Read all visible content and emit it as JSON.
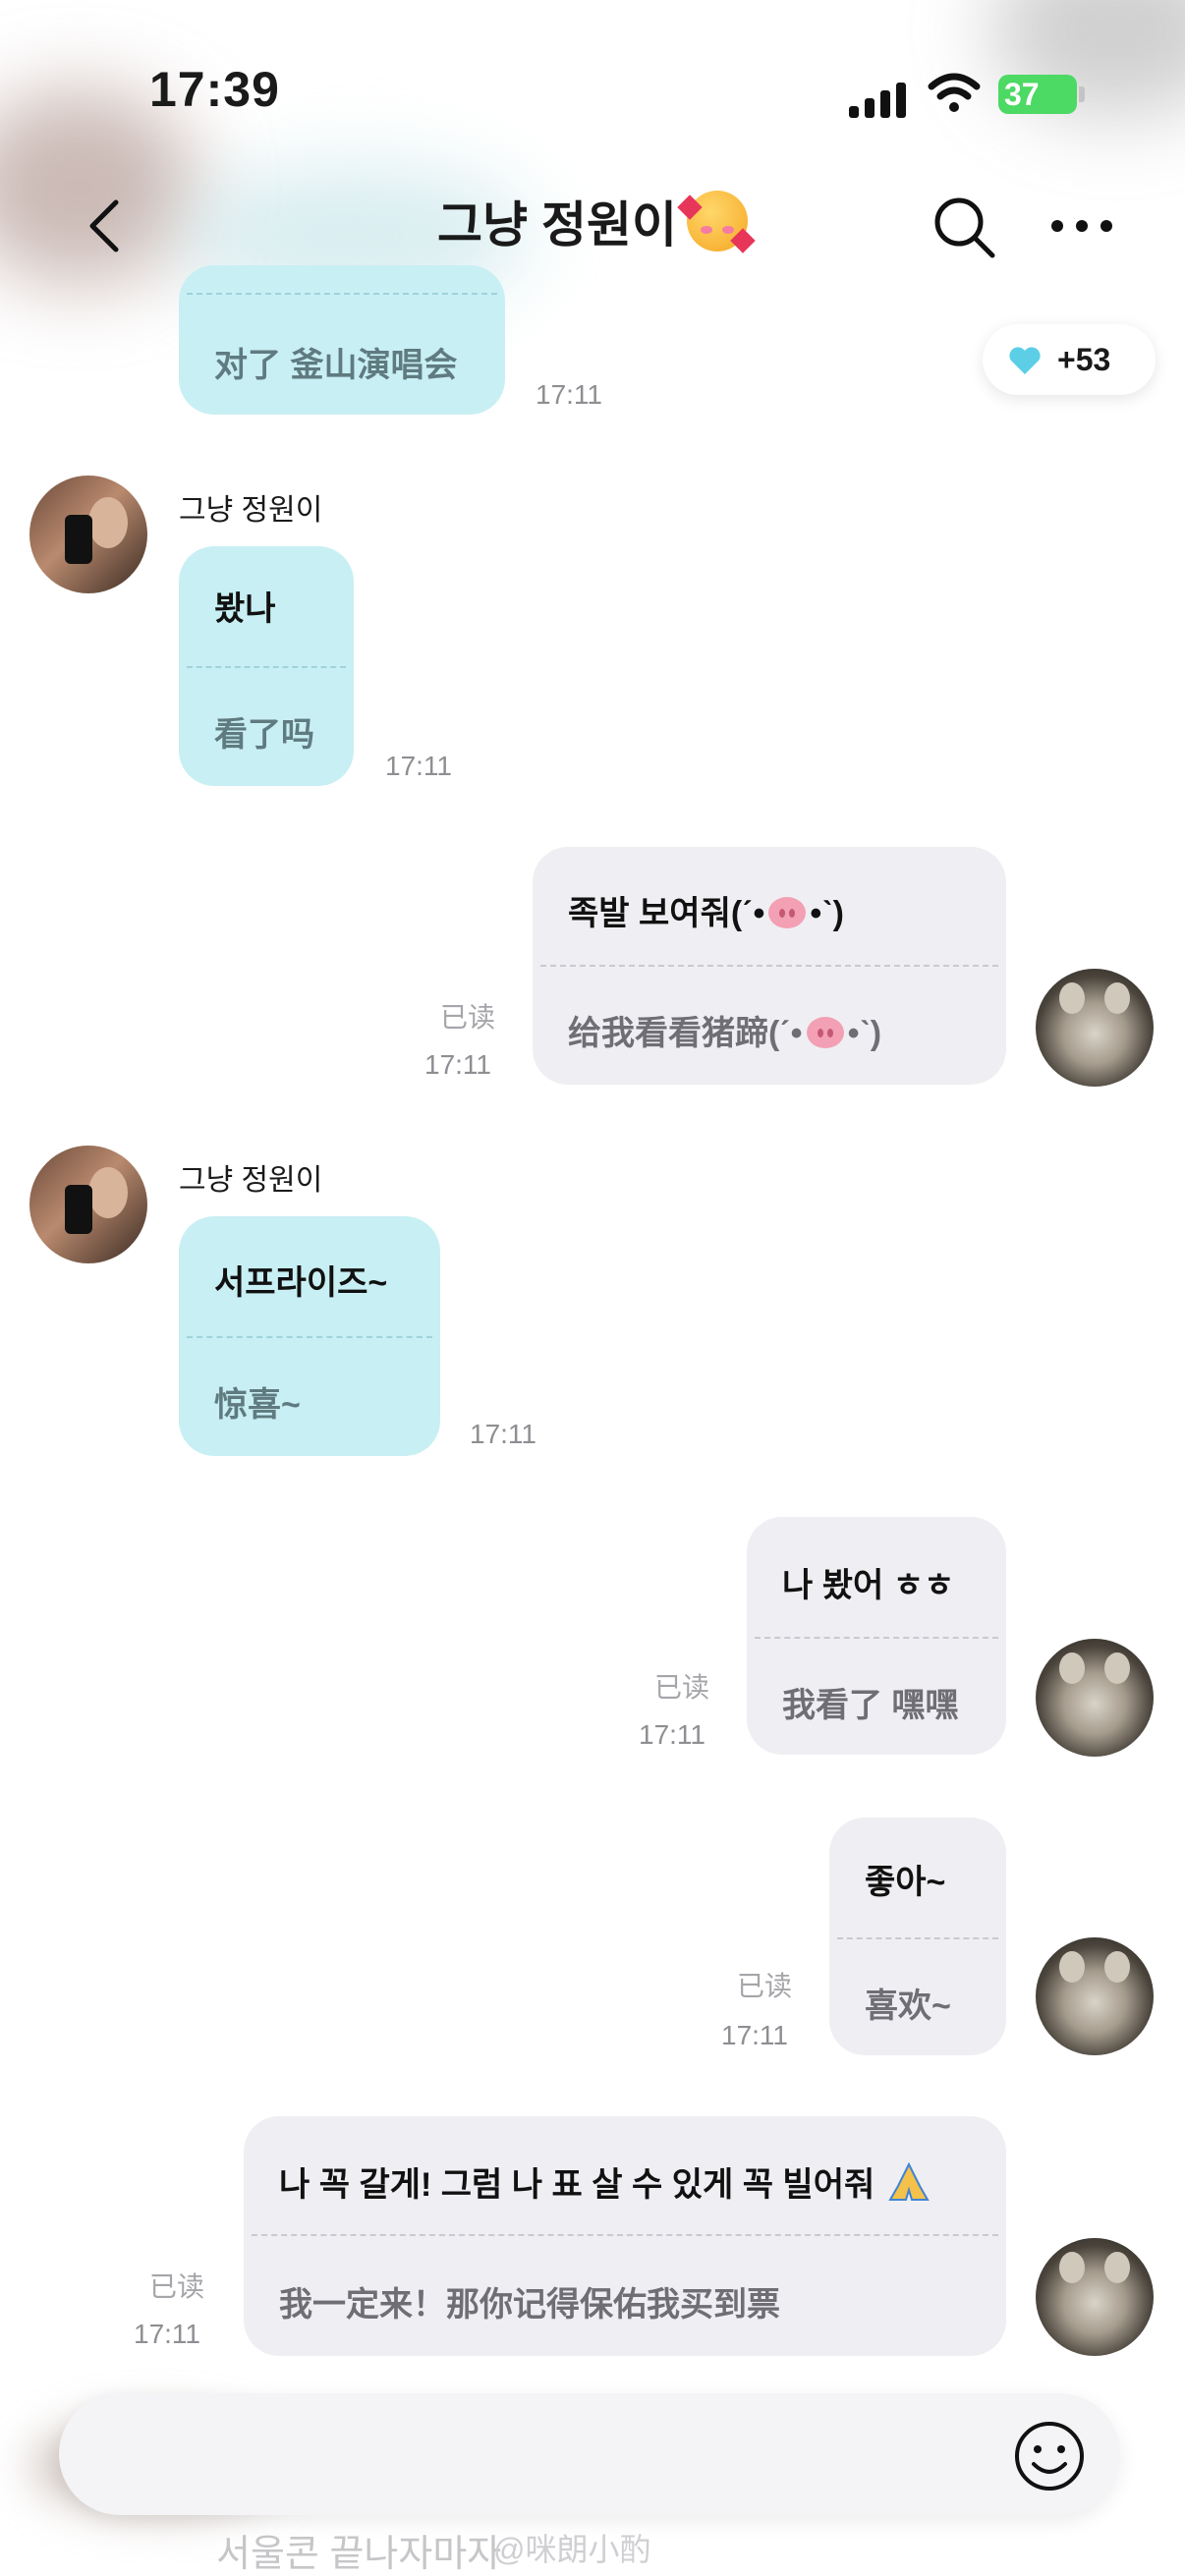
{
  "status_bar": {
    "time": "17:39",
    "battery": "37"
  },
  "header": {
    "title": "그냥 정원이",
    "title_emoji": "smiling-face-with-hearts-icon"
  },
  "like_badge": {
    "count": "+53",
    "color": "#5ccfe6"
  },
  "colors": {
    "incoming_bubble": "#c8eff4",
    "outgoing_bubble": "#efeff3"
  },
  "messages": [
    {
      "direction": "in",
      "lines": [
        "对了 釜山演唱会"
      ],
      "time": "17:11"
    },
    {
      "direction": "in",
      "sender": "그냥 정원이",
      "lines": [
        "봤나",
        "看了吗"
      ],
      "time": "17:11"
    },
    {
      "direction": "out",
      "lines": [
        "족발 보여줘(ˊ•",
        "•ˋ)",
        "给我看看猪蹄(ˊ•",
        "•ˋ)"
      ],
      "read": "已读",
      "time": "17:11"
    },
    {
      "direction": "in",
      "sender": "그냥 정원이",
      "lines": [
        "서프라이즈~",
        "惊喜~"
      ],
      "time": "17:11"
    },
    {
      "direction": "out",
      "lines": [
        "나 봤어 ㅎㅎ",
        "我看了 嘿嘿"
      ],
      "read": "已读",
      "time": "17:11"
    },
    {
      "direction": "out",
      "lines": [
        "좋아~",
        "喜欢~"
      ],
      "read": "已读",
      "time": "17:11"
    },
    {
      "direction": "out",
      "lines": [
        "나 꼭 갈게! 그럼 나 표 살 수 있게 꼭 빌어줘",
        "我一定来！那你记得保佑我买到票"
      ],
      "read": "已读",
      "time": "17:11"
    }
  ],
  "input": {
    "faded_preview": "서울콘 끝나자마자",
    "watermark": "@咪朗小酌"
  }
}
